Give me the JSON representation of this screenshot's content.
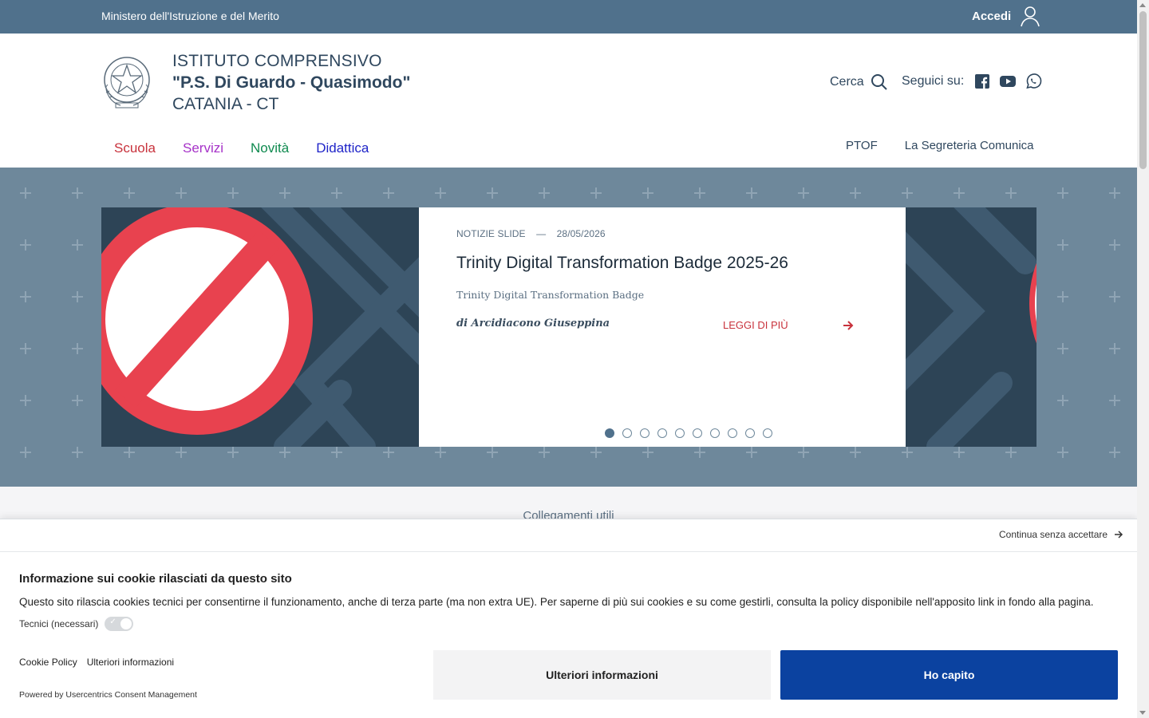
{
  "topbar": {
    "ministry": "Ministero dell'Istruzione e del Merito",
    "login_label": "Accedi",
    "login_icon": "user-icon"
  },
  "header": {
    "emblem_icon": "repubblica-italiana-emblem",
    "school_line1": "ISTITUTO COMPRENSIVO",
    "school_line2": "\"P.S. Di Guardo - Quasimodo\"",
    "school_line3": "CATANIA - CT",
    "search_label": "Cerca",
    "social_label": "Seguici su:",
    "social_icons": [
      "facebook-icon",
      "youtube-icon",
      "whatsapp-icon"
    ]
  },
  "nav": {
    "main": [
      {
        "label": "Scuola",
        "color": "#c8323c"
      },
      {
        "label": "Servizi",
        "color": "#a632c8"
      },
      {
        "label": "Novità",
        "color": "#0f8a4f"
      },
      {
        "label": "Didattica",
        "color": "#1f24c8"
      }
    ],
    "secondary": [
      "PTOF",
      "La Segreteria Comunica"
    ]
  },
  "carousel": {
    "category": "NOTIZIE SLIDE",
    "separator": "—",
    "date": "28/05/2026",
    "title": "Trinity Digital Transformation Badge 2025-26",
    "subtitle": "Trinity Digital Transformation Badge",
    "author": "di Arcidiacono Giuseppina",
    "read_more": "LEGGI DI PIÙ",
    "slide_count": 10,
    "active_slide": 1
  },
  "links": {
    "label": "Collegamenti utili"
  },
  "cookie": {
    "skip_label": "Continua senza accettare",
    "heading": "Informazione sui cookie rilasciati da questo sito",
    "text": "Questo sito rilascia cookies tecnici per consentirne il funzionamento, anche di terza parte (ma non extra UE). Per saperne di più sui cookies e su come gestirli, consulta la policy disponibile nell'apposito link in fondo alla pagina.",
    "toggle_label": "Tecnici (necessari)",
    "policy_link": "Cookie Policy",
    "more_link": "Ulteriori informazioni",
    "powered": "Powered by Usercentrics Consent Management",
    "btn_more": "Ulteriori informazioni",
    "btn_accept": "Ho capito"
  },
  "colors": {
    "topbar": "#50718c",
    "hero": "#6e889b",
    "accent_red": "#c8323c",
    "accept_blue": "#0b42a0"
  }
}
